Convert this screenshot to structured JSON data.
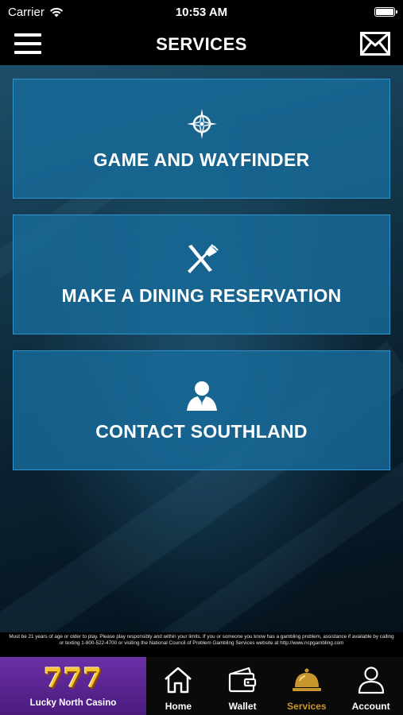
{
  "status_bar": {
    "carrier": "Carrier",
    "time": "10:53 AM"
  },
  "header": {
    "title": "SERVICES",
    "menu_icon": "hamburger-icon",
    "mail_icon": "mail-icon"
  },
  "services": [
    {
      "label": "GAME AND WAYFINDER",
      "icon": "compass-icon"
    },
    {
      "label": "MAKE A DINING RESERVATION",
      "icon": "fork-knife-icon"
    },
    {
      "label": "CONTACT SOUTHLAND",
      "icon": "person-icon"
    }
  ],
  "disclaimer": "Must be 21 years of age or older to play. Please play responsibly and within your limits. If you or someone you know has a gambling problem, assistance if available by calling or texting 1-800-522-4700 or visiting the National Council of Problem Gambling Services website at http://www.ncpgambling.com",
  "tab_bar": {
    "promo": {
      "logo_text": "777",
      "label": "Lucky North Casino"
    },
    "tabs": [
      {
        "label": "Home",
        "icon": "home-icon"
      },
      {
        "label": "Wallet",
        "icon": "wallet-icon"
      },
      {
        "label": "Services",
        "icon": "service-bell-icon",
        "active": true
      },
      {
        "label": "Account",
        "icon": "account-icon"
      }
    ]
  },
  "colors": {
    "tile_fill": "#176b9b",
    "tile_border": "#2f93cc",
    "active_tab": "#c9952d",
    "promo_bg": "#5a25903"
  }
}
